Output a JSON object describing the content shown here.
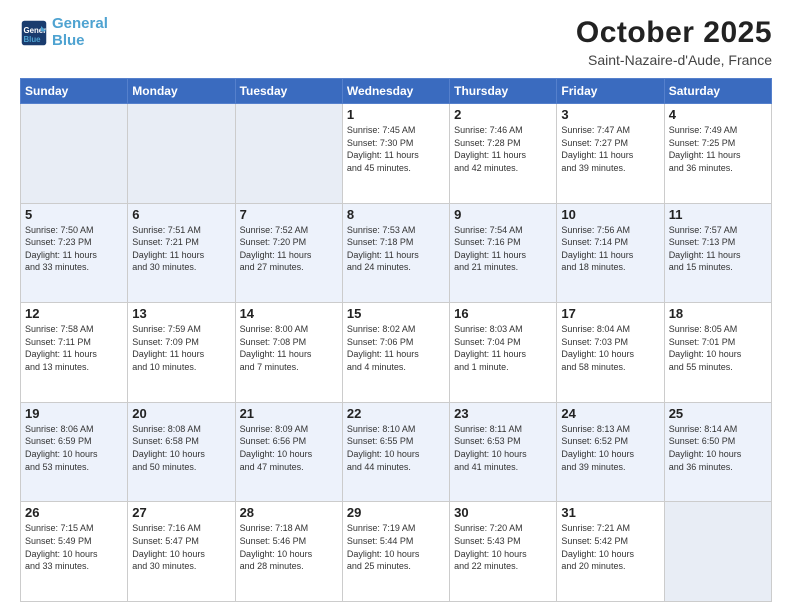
{
  "logo": {
    "line1": "General",
    "line2": "Blue"
  },
  "title": "October 2025",
  "subtitle": "Saint-Nazaire-d'Aude, France",
  "days_of_week": [
    "Sunday",
    "Monday",
    "Tuesday",
    "Wednesday",
    "Thursday",
    "Friday",
    "Saturday"
  ],
  "weeks": [
    [
      {
        "day": "",
        "info": ""
      },
      {
        "day": "",
        "info": ""
      },
      {
        "day": "",
        "info": ""
      },
      {
        "day": "1",
        "info": "Sunrise: 7:45 AM\nSunset: 7:30 PM\nDaylight: 11 hours\nand 45 minutes."
      },
      {
        "day": "2",
        "info": "Sunrise: 7:46 AM\nSunset: 7:28 PM\nDaylight: 11 hours\nand 42 minutes."
      },
      {
        "day": "3",
        "info": "Sunrise: 7:47 AM\nSunset: 7:27 PM\nDaylight: 11 hours\nand 39 minutes."
      },
      {
        "day": "4",
        "info": "Sunrise: 7:49 AM\nSunset: 7:25 PM\nDaylight: 11 hours\nand 36 minutes."
      }
    ],
    [
      {
        "day": "5",
        "info": "Sunrise: 7:50 AM\nSunset: 7:23 PM\nDaylight: 11 hours\nand 33 minutes."
      },
      {
        "day": "6",
        "info": "Sunrise: 7:51 AM\nSunset: 7:21 PM\nDaylight: 11 hours\nand 30 minutes."
      },
      {
        "day": "7",
        "info": "Sunrise: 7:52 AM\nSunset: 7:20 PM\nDaylight: 11 hours\nand 27 minutes."
      },
      {
        "day": "8",
        "info": "Sunrise: 7:53 AM\nSunset: 7:18 PM\nDaylight: 11 hours\nand 24 minutes."
      },
      {
        "day": "9",
        "info": "Sunrise: 7:54 AM\nSunset: 7:16 PM\nDaylight: 11 hours\nand 21 minutes."
      },
      {
        "day": "10",
        "info": "Sunrise: 7:56 AM\nSunset: 7:14 PM\nDaylight: 11 hours\nand 18 minutes."
      },
      {
        "day": "11",
        "info": "Sunrise: 7:57 AM\nSunset: 7:13 PM\nDaylight: 11 hours\nand 15 minutes."
      }
    ],
    [
      {
        "day": "12",
        "info": "Sunrise: 7:58 AM\nSunset: 7:11 PM\nDaylight: 11 hours\nand 13 minutes."
      },
      {
        "day": "13",
        "info": "Sunrise: 7:59 AM\nSunset: 7:09 PM\nDaylight: 11 hours\nand 10 minutes."
      },
      {
        "day": "14",
        "info": "Sunrise: 8:00 AM\nSunset: 7:08 PM\nDaylight: 11 hours\nand 7 minutes."
      },
      {
        "day": "15",
        "info": "Sunrise: 8:02 AM\nSunset: 7:06 PM\nDaylight: 11 hours\nand 4 minutes."
      },
      {
        "day": "16",
        "info": "Sunrise: 8:03 AM\nSunset: 7:04 PM\nDaylight: 11 hours\nand 1 minute."
      },
      {
        "day": "17",
        "info": "Sunrise: 8:04 AM\nSunset: 7:03 PM\nDaylight: 10 hours\nand 58 minutes."
      },
      {
        "day": "18",
        "info": "Sunrise: 8:05 AM\nSunset: 7:01 PM\nDaylight: 10 hours\nand 55 minutes."
      }
    ],
    [
      {
        "day": "19",
        "info": "Sunrise: 8:06 AM\nSunset: 6:59 PM\nDaylight: 10 hours\nand 53 minutes."
      },
      {
        "day": "20",
        "info": "Sunrise: 8:08 AM\nSunset: 6:58 PM\nDaylight: 10 hours\nand 50 minutes."
      },
      {
        "day": "21",
        "info": "Sunrise: 8:09 AM\nSunset: 6:56 PM\nDaylight: 10 hours\nand 47 minutes."
      },
      {
        "day": "22",
        "info": "Sunrise: 8:10 AM\nSunset: 6:55 PM\nDaylight: 10 hours\nand 44 minutes."
      },
      {
        "day": "23",
        "info": "Sunrise: 8:11 AM\nSunset: 6:53 PM\nDaylight: 10 hours\nand 41 minutes."
      },
      {
        "day": "24",
        "info": "Sunrise: 8:13 AM\nSunset: 6:52 PM\nDaylight: 10 hours\nand 39 minutes."
      },
      {
        "day": "25",
        "info": "Sunrise: 8:14 AM\nSunset: 6:50 PM\nDaylight: 10 hours\nand 36 minutes."
      }
    ],
    [
      {
        "day": "26",
        "info": "Sunrise: 7:15 AM\nSunset: 5:49 PM\nDaylight: 10 hours\nand 33 minutes."
      },
      {
        "day": "27",
        "info": "Sunrise: 7:16 AM\nSunset: 5:47 PM\nDaylight: 10 hours\nand 30 minutes."
      },
      {
        "day": "28",
        "info": "Sunrise: 7:18 AM\nSunset: 5:46 PM\nDaylight: 10 hours\nand 28 minutes."
      },
      {
        "day": "29",
        "info": "Sunrise: 7:19 AM\nSunset: 5:44 PM\nDaylight: 10 hours\nand 25 minutes."
      },
      {
        "day": "30",
        "info": "Sunrise: 7:20 AM\nSunset: 5:43 PM\nDaylight: 10 hours\nand 22 minutes."
      },
      {
        "day": "31",
        "info": "Sunrise: 7:21 AM\nSunset: 5:42 PM\nDaylight: 10 hours\nand 20 minutes."
      },
      {
        "day": "",
        "info": ""
      }
    ]
  ]
}
